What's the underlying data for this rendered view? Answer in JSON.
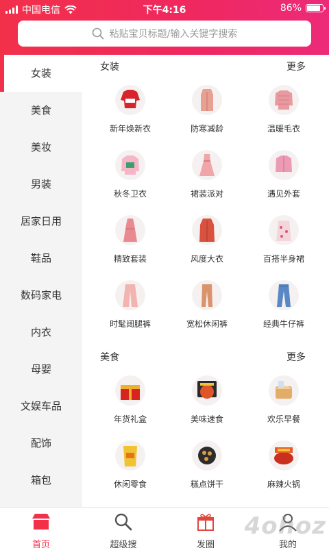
{
  "status": {
    "carrier": "中国电信",
    "time": "下午4:16",
    "battery": "86%",
    "battery_level": 0.86
  },
  "search": {
    "placeholder": "粘贴宝贝标题/输入关键字搜索"
  },
  "sidebar": {
    "active_index": 0,
    "items": [
      {
        "label": "女装"
      },
      {
        "label": "美食"
      },
      {
        "label": "美妆"
      },
      {
        "label": "男装"
      },
      {
        "label": "居家日用"
      },
      {
        "label": "鞋品"
      },
      {
        "label": "数码家电"
      },
      {
        "label": "内衣"
      },
      {
        "label": "母婴"
      },
      {
        "label": "文娱车品"
      },
      {
        "label": "配饰"
      },
      {
        "label": "箱包"
      }
    ]
  },
  "sections": [
    {
      "title": "女装",
      "more": "更多",
      "items": [
        {
          "label": "新年焕新衣",
          "icon": "red-sweater-icon"
        },
        {
          "label": "防寒减龄",
          "icon": "pink-coat-icon"
        },
        {
          "label": "温暖毛衣",
          "icon": "pink-knit-sweater-icon"
        },
        {
          "label": "秋冬卫衣",
          "icon": "pink-hoodie-icon"
        },
        {
          "label": "裙装派对",
          "icon": "pink-dress-icon"
        },
        {
          "label": "遇见外套",
          "icon": "pink-jacket-icon"
        },
        {
          "label": "精致套装",
          "icon": "rose-long-dress-icon"
        },
        {
          "label": "风度大衣",
          "icon": "red-overcoat-icon"
        },
        {
          "label": "百搭半身裙",
          "icon": "floral-skirt-icon"
        },
        {
          "label": "时髦阔腿裤",
          "icon": "wide-leg-pants-icon"
        },
        {
          "label": "宽松休闲裤",
          "icon": "casual-pants-icon"
        },
        {
          "label": "经典牛仔裤",
          "icon": "jeans-icon"
        }
      ]
    },
    {
      "title": "美食",
      "more": "更多",
      "items": [
        {
          "label": "年货礼盒",
          "icon": "gift-box-icon"
        },
        {
          "label": "美味速食",
          "icon": "instant-food-icon"
        },
        {
          "label": "欢乐早餐",
          "icon": "bread-icon"
        },
        {
          "label": "休闲零食",
          "icon": "snack-bag-icon"
        },
        {
          "label": "糕点饼干",
          "icon": "cookies-icon"
        },
        {
          "label": "麻辣火锅",
          "icon": "hotpot-icon"
        }
      ]
    }
  ],
  "tabbar": {
    "active_index": 0,
    "items": [
      {
        "label": "首页",
        "icon": "home-store-icon"
      },
      {
        "label": "超级搜",
        "icon": "search-icon"
      },
      {
        "label": "发圈",
        "icon": "gift-icon"
      },
      {
        "label": "我的",
        "icon": "user-icon"
      }
    ]
  },
  "watermark": "4ohoz",
  "colors": {
    "accent": "#f2304a",
    "header_end": "#ec2a78"
  }
}
